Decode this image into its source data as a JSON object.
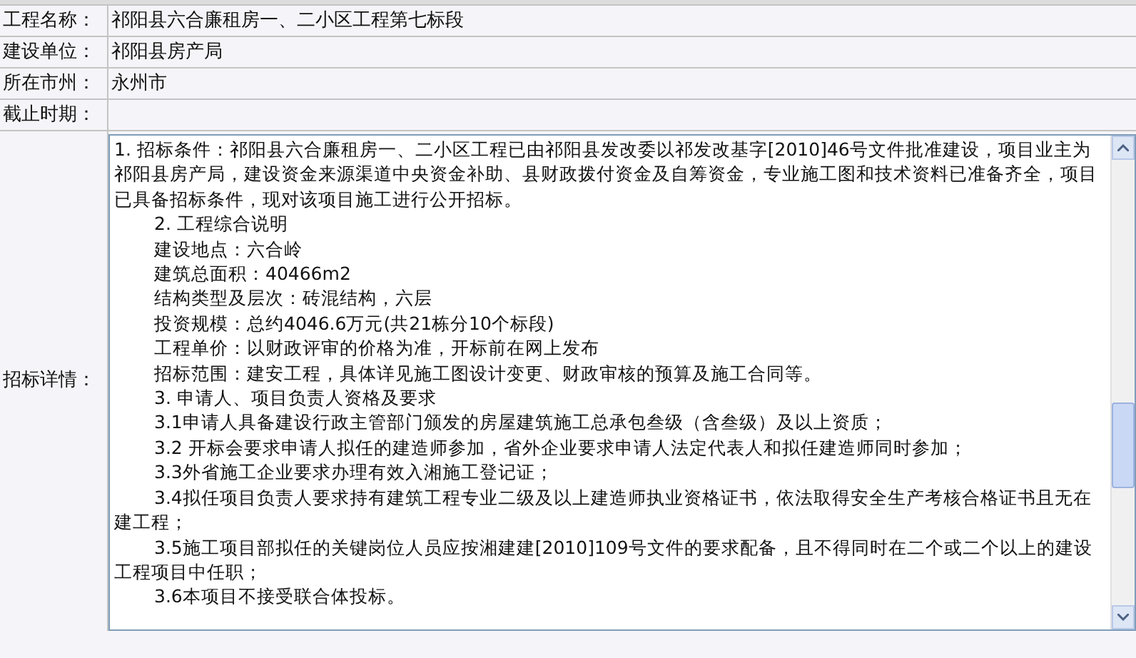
{
  "fields": [
    {
      "label": "工程名称：",
      "value": "祁阳县六合廉租房一、二小区工程第七标段"
    },
    {
      "label": "建设单位：",
      "value": "祁阳县房产局"
    },
    {
      "label": "所在市州：",
      "value": "永州市"
    },
    {
      "label": "截止时期："
    }
  ],
  "details": {
    "label": "招标详情：",
    "paragraphs": [
      {
        "kind": "plain",
        "text": "1. 招标条件：祁阳县六合廉租房一、二小区工程已由祁阳县发改委以祁发改基字[2010]46号文件批准建设，项目业主为祁阳县房产局，建设资金来源渠道中央资金补助、县财政拨付资金及自筹资金，专业施工图和技术资料已准备齐全，项目已具备招标条件，现对该项目施工进行公开招标。"
      },
      {
        "kind": "indented",
        "text": "2.  工程综合说明"
      },
      {
        "kind": "indented",
        "text": "建设地点：六合岭"
      },
      {
        "kind": "indented",
        "text": "建筑总面积：40466m2"
      },
      {
        "kind": "indented",
        "text": "结构类型及层次：砖混结构，六层"
      },
      {
        "kind": "indented",
        "text": "投资规模：总约4046.6万元(共21栋分10个标段)"
      },
      {
        "kind": "indented",
        "text": "工程单价：以财政评审的价格为准，开标前在网上发布"
      },
      {
        "kind": "indented",
        "text": "招标范围：建安工程，具体详见施工图设计变更、财政审核的预算及施工合同等。"
      },
      {
        "kind": "indented",
        "text": "3. 申请人、项目负责人资格及要求"
      },
      {
        "kind": "indented",
        "text": "3.1申请人具备建设行政主管部门颁发的房屋建筑施工总承包叁级（含叁级）及以上资质；"
      },
      {
        "kind": "indented",
        "text": "3.2 开标会要求申请人拟任的建造师参加，省外企业要求申请人法定代表人和拟任建造师同时参加；"
      },
      {
        "kind": "indented",
        "text": "3.3外省施工企业要求办理有效入湘施工登记证；"
      },
      {
        "kind": "indented",
        "text": "3.4拟任项目负责人要求持有建筑工程专业二级及以上建造师执业资格证书，依法取得安全生产考核合格证书且无在建工程；"
      },
      {
        "kind": "indented",
        "text": "3.5施工项目部拟任的关键岗位人员应按湘建建[2010]109号文件的要求配备，且不得同时在二个或二个以上的建设工程项目中任职；"
      },
      {
        "kind": "indented",
        "text": "3.6本项目不接受联合体投标。"
      }
    ]
  }
}
